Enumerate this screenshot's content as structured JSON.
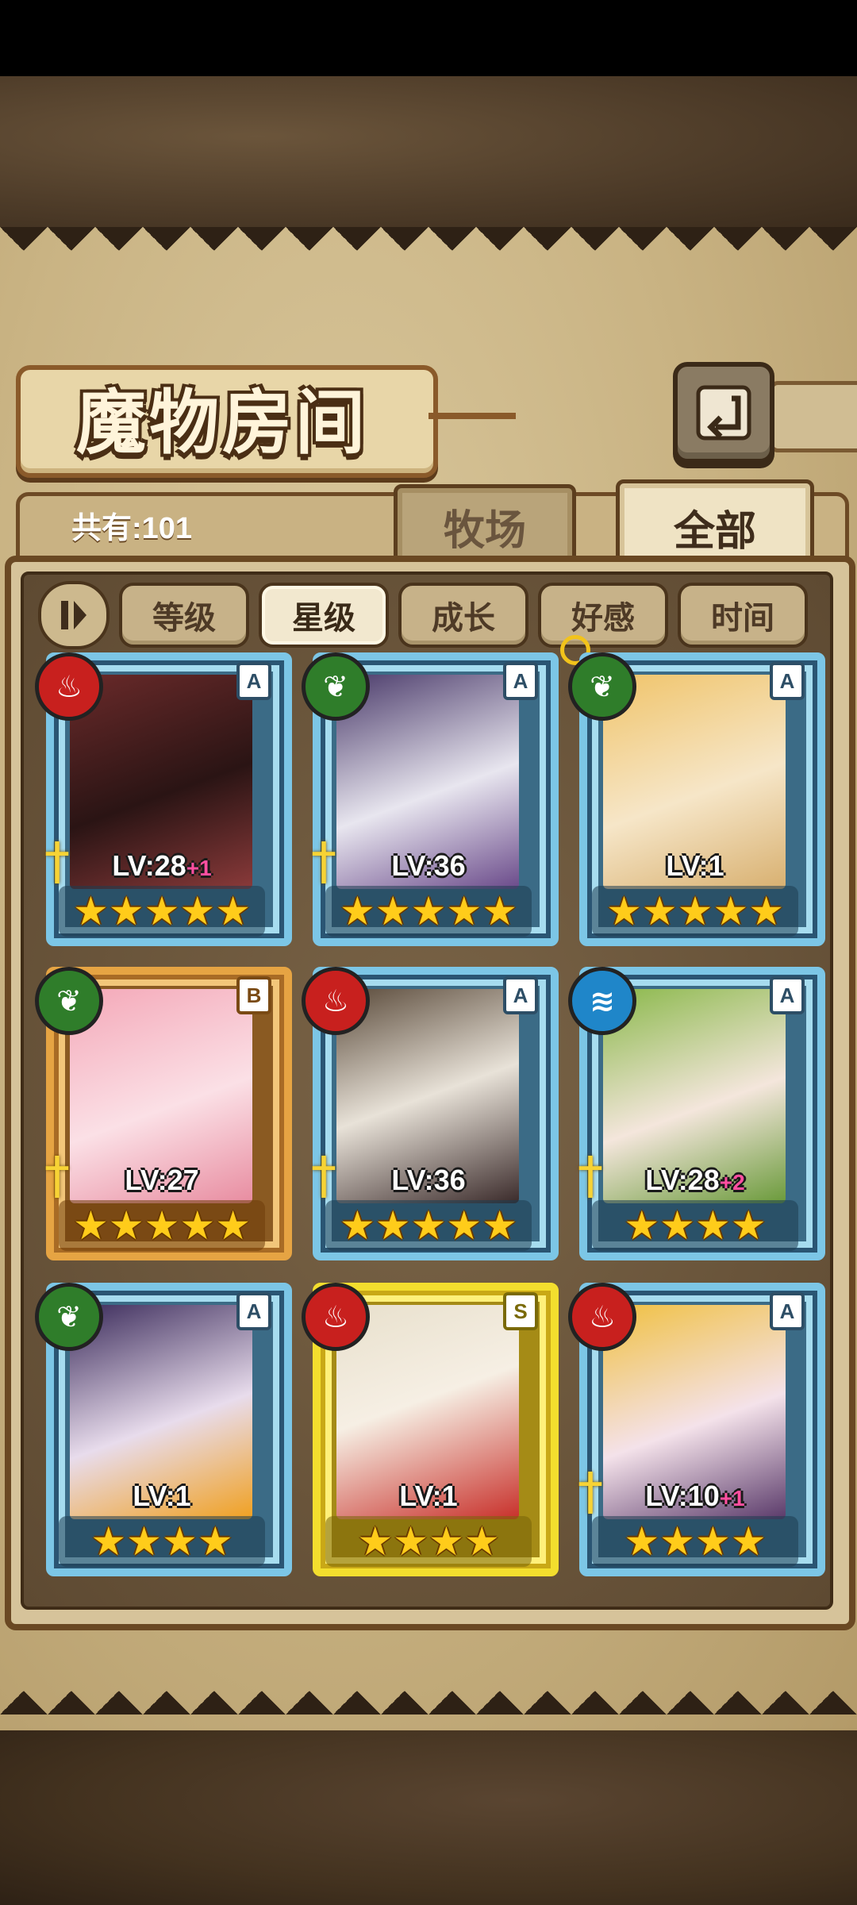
{
  "title": "魔物房间",
  "count_text": "共有:101",
  "tabs": {
    "ranch": "牧场",
    "all": "全部"
  },
  "sort": {
    "toggle_icon": "sort-toggle-icon",
    "buttons": [
      "等级",
      "星级",
      "成长",
      "好感",
      "时间"
    ],
    "active": "星级"
  },
  "element_colors": {
    "fire": "#c8201e",
    "leaf": "#2f7d2a",
    "water": "#1f86c9"
  },
  "cards": [
    {
      "element": "fire",
      "rank": "A",
      "lv": "LV:28",
      "plus": "+1",
      "stars": "★★★★★"
    },
    {
      "element": "leaf",
      "rank": "A",
      "lv": "LV:36",
      "plus": "",
      "stars": "★★★★★"
    },
    {
      "element": "leaf",
      "rank": "A",
      "lv": "LV:1",
      "plus": "",
      "stars": "★★★★★"
    },
    {
      "element": "leaf",
      "rank": "B",
      "lv": "LV:27",
      "plus": "",
      "stars": "★★★★★"
    },
    {
      "element": "fire",
      "rank": "A",
      "lv": "LV:36",
      "plus": "",
      "stars": "★★★★★"
    },
    {
      "element": "water",
      "rank": "A",
      "lv": "LV:28",
      "plus": "+2",
      "stars": "★★★★"
    },
    {
      "element": "leaf",
      "rank": "A",
      "lv": "LV:1",
      "plus": "",
      "stars": "★★★★"
    },
    {
      "element": "fire",
      "rank": "S",
      "lv": "LV:1",
      "plus": "",
      "stars": "★★★★"
    },
    {
      "element": "fire",
      "rank": "A",
      "lv": "LV:10",
      "plus": "+1",
      "stars": "★★★★"
    }
  ]
}
